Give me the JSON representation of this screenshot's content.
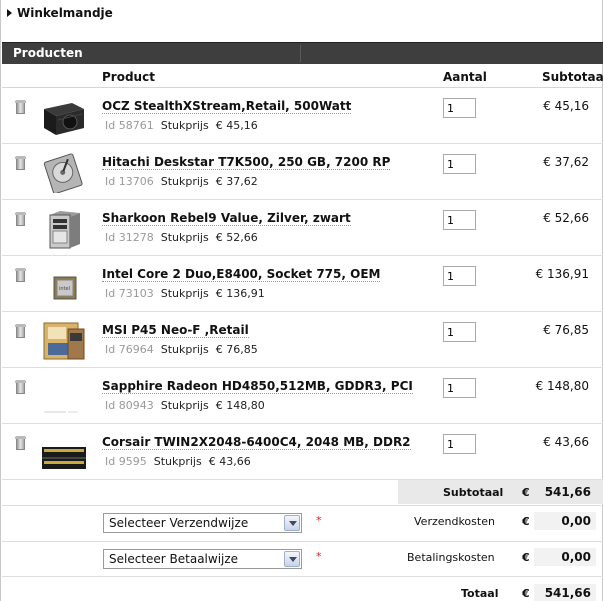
{
  "cart": {
    "title": "Winkelmandje"
  },
  "section": {
    "title": "Producten"
  },
  "columns": {
    "product": "Product",
    "quantity": "Aantal",
    "subtotal": "Subtotaal"
  },
  "labels": {
    "id": "Id",
    "unit_price": "Stukprijs"
  },
  "products": [
    {
      "name": "OCZ StealthXStream,Retail, 500Watt",
      "id": "58761",
      "unit_price": "€ 45,16",
      "qty": "1",
      "subtotal": "€ 45,16",
      "image": "power-supply"
    },
    {
      "name": "Hitachi Deskstar T7K500, 250 GB, 7200 RP",
      "id": "13706",
      "unit_price": "€ 37,62",
      "qty": "1",
      "subtotal": "€ 37,62",
      "image": "hard-drive"
    },
    {
      "name": "Sharkoon Rebel9 Value, Zilver, zwart",
      "id": "31278",
      "unit_price": "€ 52,66",
      "qty": "1",
      "subtotal": "€ 52,66",
      "image": "pc-case"
    },
    {
      "name": "Intel Core 2 Duo,E8400, Socket 775, OEM",
      "id": "73103",
      "unit_price": "€ 136,91",
      "qty": "1",
      "subtotal": "€ 136,91",
      "image": "cpu"
    },
    {
      "name": "MSI P45 Neo-F ,Retail",
      "id": "76964",
      "unit_price": "€ 76,85",
      "qty": "1",
      "subtotal": "€ 76,85",
      "image": "motherboard"
    },
    {
      "name": "Sapphire Radeon HD4850,512MB, GDDR3, PCI",
      "id": "80943",
      "unit_price": "€ 148,80",
      "qty": "1",
      "subtotal": "€ 148,80",
      "image": "graphics-card"
    },
    {
      "name": "Corsair TWIN2X2048-6400C4, 2048 MB, DDR2",
      "id": "9595",
      "unit_price": "€ 43,66",
      "qty": "1",
      "subtotal": "€ 43,66",
      "image": "ram"
    }
  ],
  "summary": {
    "subtotal_label": "Subtotaal",
    "currency": "€",
    "subtotal": "541,66",
    "shipping_select": "Selecteer Verzendwijze",
    "shipping_label": "Verzendkosten",
    "shipping_cost": "0,00",
    "payment_select": "Selecteer Betaalwijze",
    "payment_label": "Betalingskosten",
    "payment_cost": "0,00",
    "required_mark": "*",
    "total_label": "Totaal",
    "total": "541,66"
  },
  "colors": {
    "header_bar": "#3e3e3e",
    "required": "#cc2222"
  }
}
